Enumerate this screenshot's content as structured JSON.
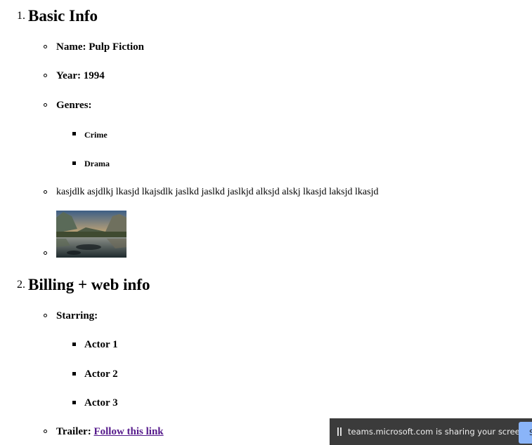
{
  "sections": [
    {
      "number": "1.",
      "title": "Basic Info",
      "items": {
        "name": "Name: Pulp Fiction",
        "year": "Year: 1994",
        "genres_label": "Genres:",
        "genres": [
          "Crime",
          "Drama"
        ],
        "description": "kasjdlk asjdlkj lkasjd lkajsdlk jaslkd jaslkd jaslkjd alksjd alskj lkasjd laksjd lkasjd",
        "image_alt": "landscape photo"
      }
    },
    {
      "number": "2.",
      "title": "Billing + web info",
      "items": {
        "starring_label": "Starring:",
        "actors": [
          "Actor 1",
          "Actor 2",
          "Actor 3"
        ],
        "trailer_label": "Trailer:",
        "trailer_link": "Follow this link"
      }
    }
  ],
  "screen_share": {
    "message": "teams.microsoft.com is sharing your screen.",
    "button_label": "S",
    "accent_color": "#8ab4f8"
  }
}
